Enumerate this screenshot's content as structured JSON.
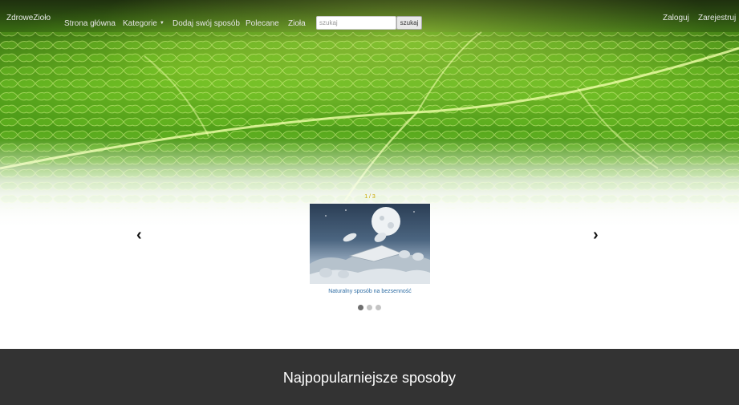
{
  "navbar": {
    "brand": "ZdroweZioło",
    "items": [
      {
        "label": "Strona główna"
      },
      {
        "label": "Kategorie",
        "dropdown": true
      },
      {
        "label": "Dodaj swój sposób"
      },
      {
        "label": "Polecane"
      },
      {
        "label": "Zioła"
      }
    ],
    "search": {
      "placeholder": "szukaj",
      "button_label": "szukaj"
    },
    "auth": {
      "login": "Zaloguj",
      "register": "Zarejestruj"
    }
  },
  "carousel": {
    "counter": "1 / 3",
    "slides": [
      {
        "caption": "Naturalny sposób na bezsenność"
      }
    ],
    "active_index": 0,
    "total_dots": 3,
    "prev_label": "‹",
    "next_label": "›"
  },
  "popular_section": {
    "title": "Najpopularniejsze sposoby"
  },
  "colors": {
    "nav_text": "#e6e6e6",
    "caption_link": "#2e6da4",
    "counter": "#c9a800",
    "dark_section": "#333333"
  }
}
